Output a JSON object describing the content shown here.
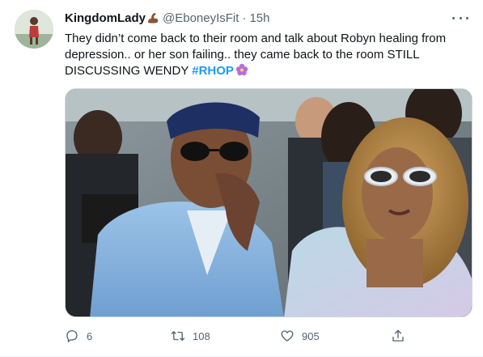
{
  "tweet": {
    "display_name": "KingdomLady",
    "handle": "@EboneyIsFit",
    "separator": "·",
    "time": "15h",
    "text_before_hashtag": "They didn’t come back to their room and talk about Robyn healing from depression.. or her son failing.. they came back to the room STILL DISCUSSING WENDY ",
    "hashtag": "#RHOP",
    "emojis": [
      "flexed-biceps-icon",
      "hibiscus-flower-icon"
    ]
  },
  "actions": {
    "reply_count": "6",
    "retweet_count": "108",
    "like_count": "905"
  },
  "icons": {
    "more": "more-dots-icon",
    "reply": "reply-icon",
    "retweet": "retweet-icon",
    "like": "heart-icon",
    "share": "share-icon"
  },
  "colors": {
    "link": "#1d9bf0",
    "secondary_text": "#536471",
    "primary_text": "#0f1419"
  }
}
